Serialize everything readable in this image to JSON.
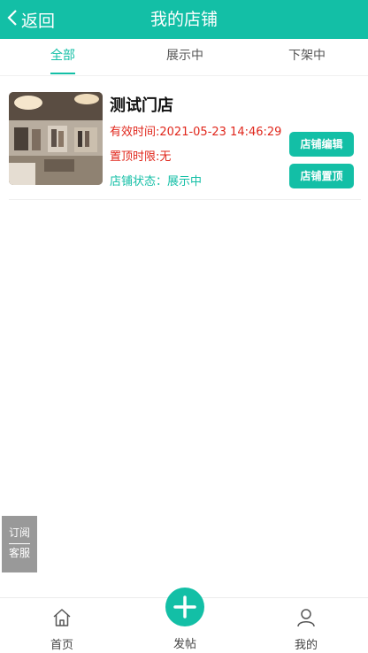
{
  "header": {
    "back_label": "返回",
    "title": "我的店铺"
  },
  "tabs": [
    {
      "label": "全部",
      "active": true
    },
    {
      "label": "展示中",
      "active": false
    },
    {
      "label": "下架中",
      "active": false
    }
  ],
  "store": {
    "name": "测试门店",
    "valid_time": "有效时间:2021-05-23 14:46:29",
    "top_limit": "置顶时限:无",
    "status": "店铺状态：展示中",
    "edit_label": "店铺编辑",
    "top_label": "店铺置顶"
  },
  "float_service": {
    "line1": "订阅",
    "line2": "客服"
  },
  "bottom_nav": {
    "home_label": "首页",
    "post_label": "发帖",
    "mine_label": "我的"
  },
  "colors": {
    "accent": "#13bfa6",
    "warning": "#e0261b",
    "float_bg": "#999999"
  },
  "icons": {
    "back": "chevron-left-icon",
    "home": "home-icon",
    "post": "plus-icon",
    "mine": "user-icon"
  }
}
